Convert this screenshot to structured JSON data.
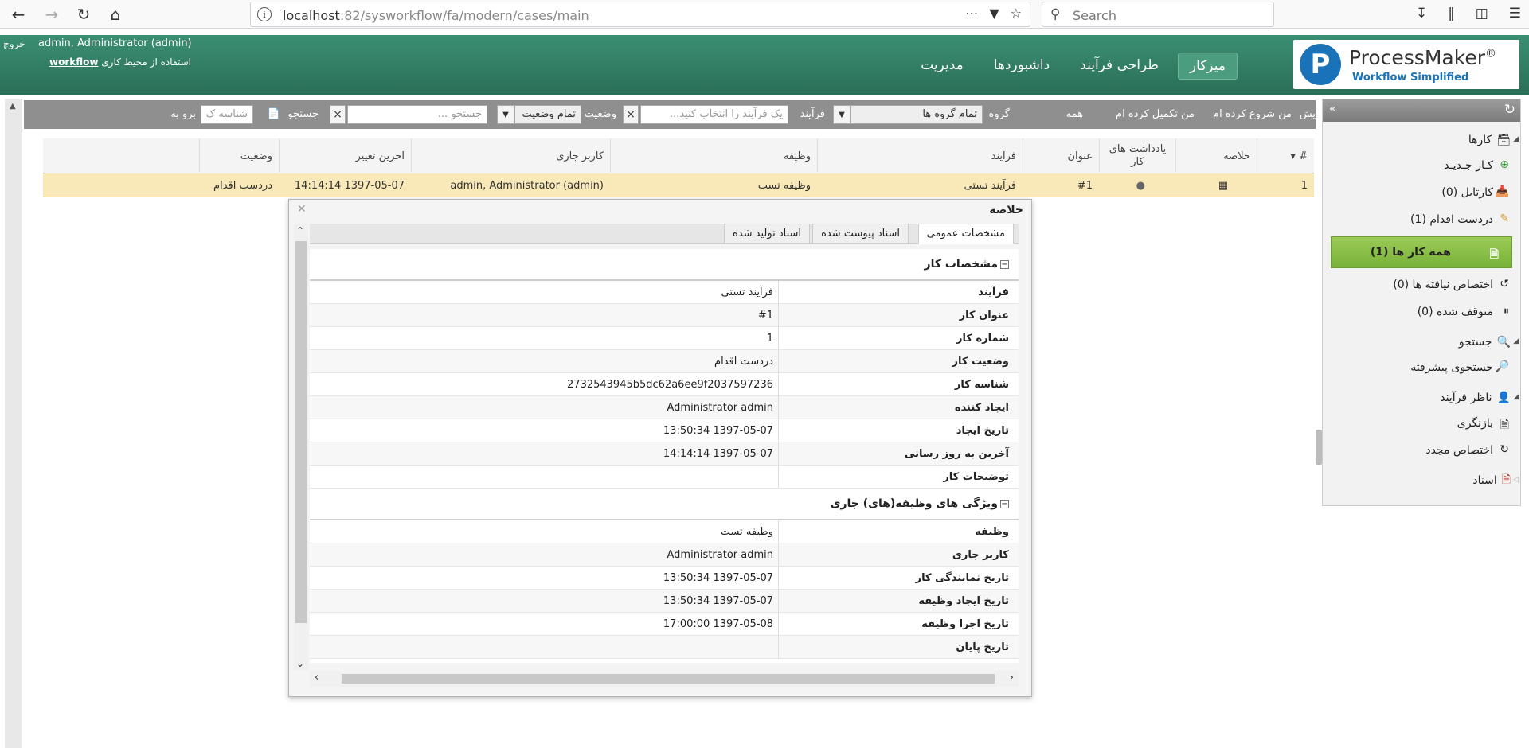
{
  "browser": {
    "url_host": "localhost",
    "url_path": ":82/sysworkflow/fa/modern/cases/main",
    "search_placeholder": "Search"
  },
  "header": {
    "logout": "خروج",
    "user": "admin, Administrator (admin)",
    "workspace_prefix": "استفاده از محیط کاری",
    "workspace_name": "workflow",
    "menu": [
      {
        "label": "میزکار"
      },
      {
        "label": "طراحی فرآیند"
      },
      {
        "label": "داشبوردها"
      },
      {
        "label": "مدیریت"
      }
    ],
    "logo_name": "ProcessMaker",
    "logo_tag": "Workflow Simplified",
    "brand_color": "#2f7b61"
  },
  "sidebar": {
    "group_cases": "کارها",
    "new_case": "کـار جـدیـد",
    "inbox": "کارتابل (0)",
    "draft": "دردست اقدام (1)",
    "all_cases": "همه کار ها (1)",
    "unassigned": "اختصاص نیافته ها (0)",
    "paused": "متوقف شده (0)",
    "group_search": "جستجو",
    "advanced_search": "جستجوی پیشرفته",
    "group_supervisor": "ناظر فرآیند",
    "review": "بازنگری",
    "reassign": "اختصاص مجدد",
    "documents": "اسناد"
  },
  "toolbar": {
    "filter_tail": "یش",
    "started_by_me": "من شروع کرده ام",
    "completed_by_me": "من تکمیل کرده ام",
    "all": "همه",
    "group_label": "گروه",
    "group_value": "تمام گروه ها",
    "process_label": "فرآیند",
    "process_placeholder": "یک فرآیند را انتخاب کنید...",
    "status_label": "وضعیت",
    "status_value": "تمام وضعیت",
    "search_placeholder": "جستجو ...",
    "search_button": "جستجو",
    "id_placeholder": "شناسه ک",
    "goto": "برو به"
  },
  "grid": {
    "headers": {
      "num": "#",
      "summary": "خلاصه",
      "notes": "یادداشت های کار",
      "title": "عنوان",
      "process": "فرآیند",
      "task": "وظیفه",
      "current_user": "کاربر جاری",
      "last_modify": "آخرین تغییر",
      "status": "وضعیت"
    },
    "row": {
      "num": "1",
      "title": "#1",
      "process": "فرآیند تستی",
      "task": "وظیفه تست",
      "current_user": "admin, Administrator (admin)",
      "last_modify": "1397-05-07 14:14:14",
      "status": "دردست اقدام"
    }
  },
  "popup": {
    "title": "خلاصه",
    "tabs": [
      "مشخصات عمومی",
      "اسناد پیوست شده",
      "اسناد تولید شده"
    ],
    "section1": "مشخصات کار",
    "fields1": [
      {
        "label": "فرآیند",
        "value": "فرآیند تستی"
      },
      {
        "label": "عنوان کار",
        "value": "#1"
      },
      {
        "label": "شماره کار",
        "value": "1"
      },
      {
        "label": "وضعیت کار",
        "value": "دردست اقدام"
      },
      {
        "label": "شناسه کار",
        "value": "2732543945b5dc62a6ee9f2037597236"
      },
      {
        "label": "ایجاد کننده",
        "value": "Administrator admin"
      },
      {
        "label": "تاریخ ایجاد",
        "value": "1397-05-07 13:50:34"
      },
      {
        "label": "آخرین به روز رسانی",
        "value": "1397-05-07 14:14:14"
      },
      {
        "label": "توضیحات کار",
        "value": ""
      }
    ],
    "section2": "ویژگی های وظیفه(های) جاری",
    "fields2": [
      {
        "label": "وظیفه",
        "value": "وظیفه تست"
      },
      {
        "label": "کاربر جاری",
        "value": "Administrator admin"
      },
      {
        "label": "تاریخ نمایندگی کار",
        "value": "1397-05-07 13:50:34"
      },
      {
        "label": "تاریخ ایجاد وظیفه",
        "value": "1397-05-07 13:50:34"
      },
      {
        "label": "تاریخ اجرا وظیفه",
        "value": "1397-05-08 17:00:00"
      },
      {
        "label": "تاریخ پایان",
        "value": ""
      }
    ]
  }
}
